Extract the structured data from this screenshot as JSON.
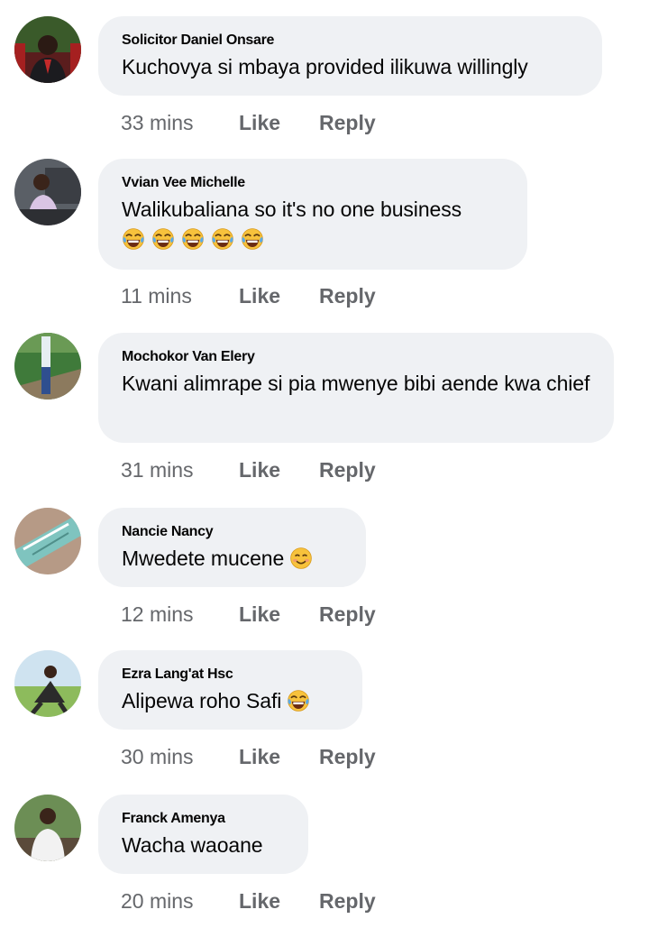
{
  "comments": [
    {
      "author": "Solicitor Daniel Onsare",
      "text": "Kuchovya si mbaya provided ilikuwa willingly",
      "time": "33 mins",
      "like": "Like",
      "reply": "Reply",
      "emojis": []
    },
    {
      "author": "Vvian Vee Michelle",
      "text": "Walikubaliana so it's no one business",
      "time": "11 mins",
      "like": "Like",
      "reply": "Reply",
      "emojis": [
        "tears-of-joy",
        "tears-of-joy",
        "tears-of-joy",
        "tears-of-joy",
        "tears-of-joy"
      ]
    },
    {
      "author": "Mochokor Van Elery",
      "text": "Kwani alimrape si pia mwenye bibi aende kwa chief",
      "time": "31 mins",
      "like": "Like",
      "reply": "Reply",
      "emojis": []
    },
    {
      "author": "Nancie Nancy",
      "text": "Mwedete mucene",
      "time": "12 mins",
      "like": "Like",
      "reply": "Reply",
      "emojis": [
        "smiling-face"
      ]
    },
    {
      "author": "Ezra Lang'at Hsc",
      "text": "Alipewa roho Safi",
      "time": "30 mins",
      "like": "Like",
      "reply": "Reply",
      "emojis": [
        "tears-of-joy"
      ]
    },
    {
      "author": "Franck Amenya",
      "text": "Wacha waoane",
      "time": "20 mins",
      "like": "Like",
      "reply": "Reply",
      "emojis": []
    }
  ],
  "colors": {
    "bubble": "#eff1f4",
    "text": "#050505",
    "meta": "#65676b",
    "emoji_face": "#f7c23c"
  }
}
